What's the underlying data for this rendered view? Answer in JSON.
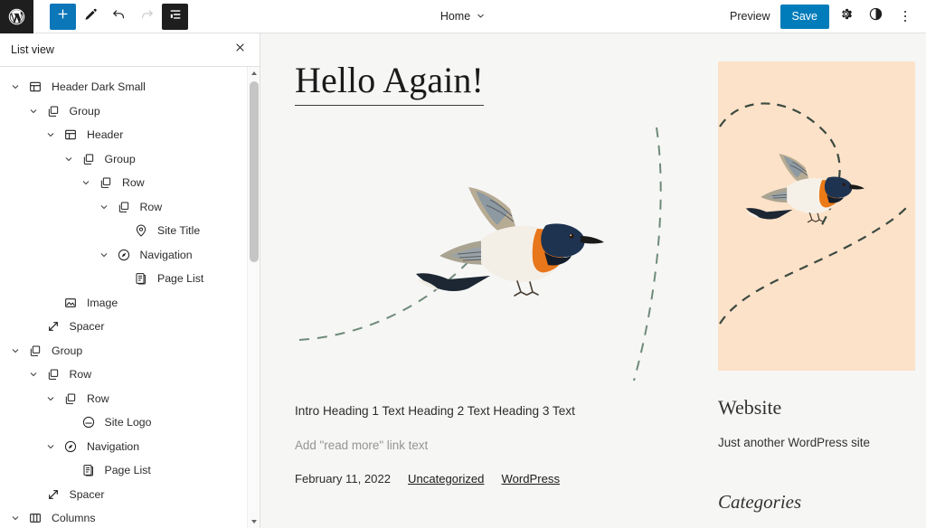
{
  "topbar": {
    "logo_icon": "wordpress-logo-icon",
    "add_block_label": "+",
    "add_block_icon": "plus-icon",
    "tools_icon": "pencil-icon",
    "undo_icon": "undo-arrow-icon",
    "redo_icon": "redo-arrow-icon",
    "list_view_icon": "list-view-icon",
    "document_title": "Home",
    "document_chevron": "▾",
    "preview_label": "Preview",
    "save_label": "Save",
    "settings_icon": "gear-icon",
    "styles_icon": "contrast-circle-icon",
    "options_icon": "kebab-menu-icon",
    "accent_color": "#007cba",
    "active_button_color": "#1e1e1e"
  },
  "sidebar": {
    "title": "List view",
    "close_icon": "close-icon",
    "scroll_up_icon": "scroll-up-arrow-icon",
    "scroll_down_icon": "scroll-down-arrow-icon",
    "blocks": [
      {
        "label": "Header Dark Small",
        "icon": "template-part-icon",
        "depth": 0,
        "expanded": true
      },
      {
        "label": "Group",
        "icon": "group-icon",
        "depth": 1,
        "expanded": true
      },
      {
        "label": "Header",
        "icon": "template-part-icon",
        "depth": 2,
        "expanded": true
      },
      {
        "label": "Group",
        "icon": "group-icon",
        "depth": 3,
        "expanded": true
      },
      {
        "label": "Row",
        "icon": "group-icon",
        "depth": 4,
        "expanded": true
      },
      {
        "label": "Row",
        "icon": "group-icon",
        "depth": 5,
        "expanded": true
      },
      {
        "label": "Site Title",
        "icon": "map-pin-icon",
        "depth": 6,
        "expanded": false
      },
      {
        "label": "Navigation",
        "icon": "compass-icon",
        "depth": 5,
        "expanded": true
      },
      {
        "label": "Page List",
        "icon": "page-list-icon",
        "depth": 6,
        "expanded": false
      },
      {
        "label": "Image",
        "icon": "image-icon",
        "depth": 2,
        "expanded": false
      },
      {
        "label": "Spacer",
        "icon": "spacer-icon",
        "depth": 1,
        "expanded": false
      },
      {
        "label": "Group",
        "icon": "group-icon",
        "depth": 0,
        "expanded": true
      },
      {
        "label": "Row",
        "icon": "group-icon",
        "depth": 1,
        "expanded": true
      },
      {
        "label": "Row",
        "icon": "group-icon",
        "depth": 2,
        "expanded": true
      },
      {
        "label": "Site Logo",
        "icon": "site-logo-icon",
        "depth": 3,
        "expanded": false
      },
      {
        "label": "Navigation",
        "icon": "compass-icon",
        "depth": 2,
        "expanded": true
      },
      {
        "label": "Page List",
        "icon": "page-list-icon",
        "depth": 3,
        "expanded": false
      },
      {
        "label": "Spacer",
        "icon": "spacer-icon",
        "depth": 1,
        "expanded": false
      },
      {
        "label": "Columns",
        "icon": "columns-icon",
        "depth": 0,
        "expanded": true
      }
    ]
  },
  "canvas": {
    "post_title": "Hello Again!",
    "featured_image_alt": "flying-swallow-bird",
    "excerpt": "Intro Heading 1 Text Heading 2 Text Heading 3 Text",
    "read_more_placeholder": "Add \"read more\" link text",
    "post_date": "February 11, 2022",
    "category_link": "Uncategorized",
    "tag_link": "WordPress",
    "sidebar_image_alt": "flying-swallow-bird-peach",
    "sidebar_image_bg": "#fce2c9",
    "site_title": "Website",
    "site_description": "Just another WordPress site",
    "categories_heading": "Categories"
  }
}
